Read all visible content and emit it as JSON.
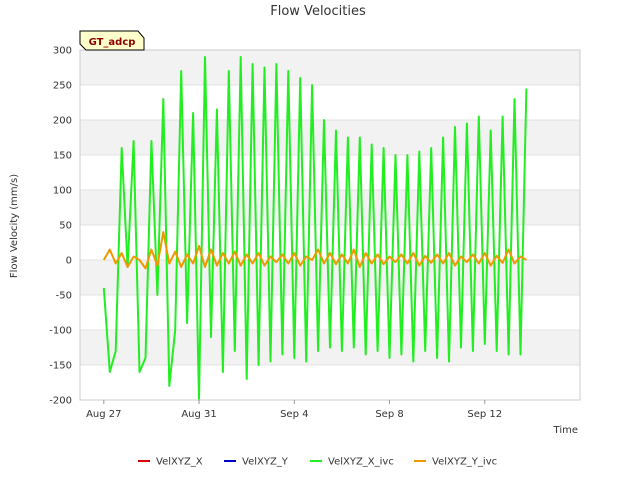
{
  "chart_data": {
    "type": "line",
    "title": "Flow Velocities",
    "xlabel": "Time",
    "ylabel": "Flow Velocity (mm/s)",
    "tag": "GT_adcp",
    "xlim": [
      "2023-08-26",
      "2023-09-16"
    ],
    "ylim": [
      -200,
      300
    ],
    "x_ticks": [
      {
        "date": "2023-08-27",
        "label": "Aug 27"
      },
      {
        "date": "2023-08-31",
        "label": "Aug 31"
      },
      {
        "date": "2023-09-04",
        "label": "Sep 4"
      },
      {
        "date": "2023-09-08",
        "label": "Sep 8"
      },
      {
        "date": "2023-09-12",
        "label": "Sep 12"
      }
    ],
    "y_ticks": [
      -200,
      -150,
      -100,
      -50,
      0,
      50,
      100,
      150,
      200,
      250,
      300
    ],
    "grid": true,
    "legend_position": "bottom",
    "x": [
      "2023-08-27 00:00",
      "2023-08-27 06:00",
      "2023-08-27 12:00",
      "2023-08-27 18:00",
      "2023-08-28 00:00",
      "2023-08-28 06:00",
      "2023-08-28 12:00",
      "2023-08-28 18:00",
      "2023-08-29 00:00",
      "2023-08-29 06:00",
      "2023-08-29 12:00",
      "2023-08-29 18:00",
      "2023-08-30 00:00",
      "2023-08-30 06:00",
      "2023-08-30 12:00",
      "2023-08-30 18:00",
      "2023-08-31 00:00",
      "2023-08-31 06:00",
      "2023-08-31 12:00",
      "2023-08-31 18:00",
      "2023-09-01 00:00",
      "2023-09-01 06:00",
      "2023-09-01 12:00",
      "2023-09-01 18:00",
      "2023-09-02 00:00",
      "2023-09-02 06:00",
      "2023-09-02 12:00",
      "2023-09-02 18:00",
      "2023-09-03 00:00",
      "2023-09-03 06:00",
      "2023-09-03 12:00",
      "2023-09-03 18:00",
      "2023-09-04 00:00",
      "2023-09-04 06:00",
      "2023-09-04 12:00",
      "2023-09-04 18:00",
      "2023-09-05 00:00",
      "2023-09-05 06:00",
      "2023-09-05 12:00",
      "2023-09-05 18:00",
      "2023-09-06 00:00",
      "2023-09-06 06:00",
      "2023-09-06 12:00",
      "2023-09-06 18:00",
      "2023-09-07 00:00",
      "2023-09-07 06:00",
      "2023-09-07 12:00",
      "2023-09-07 18:00",
      "2023-09-08 00:00",
      "2023-09-08 06:00",
      "2023-09-08 12:00",
      "2023-09-08 18:00",
      "2023-09-09 00:00",
      "2023-09-09 06:00",
      "2023-09-09 12:00",
      "2023-09-09 18:00",
      "2023-09-10 00:00",
      "2023-09-10 06:00",
      "2023-09-10 12:00",
      "2023-09-10 18:00",
      "2023-09-11 00:00",
      "2023-09-11 06:00",
      "2023-09-11 12:00",
      "2023-09-11 18:00",
      "2023-09-12 00:00",
      "2023-09-12 06:00",
      "2023-09-12 12:00",
      "2023-09-12 18:00",
      "2023-09-13 00:00",
      "2023-09-13 06:00",
      "2023-09-13 12:00",
      "2023-09-13 18:00"
    ],
    "series": [
      {
        "name": "VelXYZ_X",
        "color": "#dd0000",
        "values": []
      },
      {
        "name": "VelXYZ_Y",
        "color": "#0000cc",
        "values": []
      },
      {
        "name": "VelXYZ_X_ivc",
        "color": "#22ee22",
        "values": [
          -40,
          -160,
          -130,
          160,
          -10,
          170,
          -160,
          -140,
          170,
          -50,
          230,
          -180,
          -100,
          270,
          -90,
          210,
          -200,
          290,
          -110,
          215,
          -160,
          270,
          -130,
          290,
          -170,
          280,
          -150,
          275,
          -145,
          280,
          -135,
          270,
          -140,
          260,
          -145,
          250,
          -130,
          200,
          -125,
          185,
          -130,
          175,
          -125,
          175,
          -135,
          165,
          -130,
          160,
          -140,
          150,
          -135,
          150,
          -145,
          155,
          -130,
          160,
          -140,
          175,
          -145,
          190,
          -125,
          195,
          -130,
          205,
          -120,
          185,
          -130,
          205,
          -135,
          230,
          -135,
          245
        ]
      },
      {
        "name": "VelXYZ_Y_ivc",
        "color": "#ee9900",
        "values": [
          0,
          15,
          -5,
          10,
          -10,
          5,
          0,
          -12,
          15,
          -8,
          40,
          -5,
          12,
          -10,
          8,
          -5,
          20,
          -10,
          15,
          -8,
          10,
          -5,
          12,
          -8,
          8,
          -5,
          10,
          -8,
          5,
          -3,
          8,
          -5,
          10,
          -8,
          5,
          0,
          15,
          -5,
          10,
          -6,
          8,
          -5,
          15,
          -10,
          10,
          -5,
          8,
          -6,
          5,
          -3,
          8,
          -5,
          10,
          -8,
          6,
          -4,
          8,
          -5,
          10,
          -8,
          5,
          -3,
          8,
          -5,
          10,
          -8,
          6,
          -4,
          15,
          -5,
          5,
          0
        ]
      }
    ]
  }
}
